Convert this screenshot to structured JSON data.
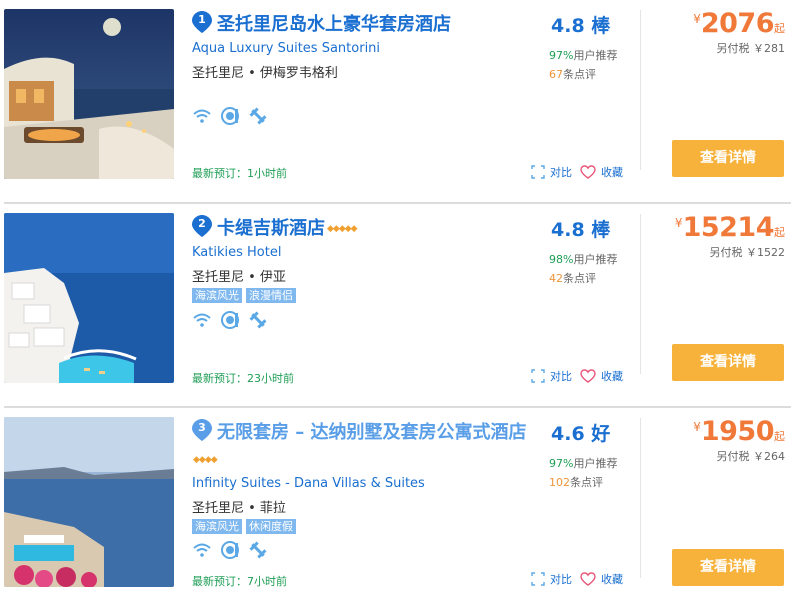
{
  "hotels": [
    {
      "rank": "1",
      "name": "圣托里尼岛水上豪华套房酒店",
      "stars_display": "",
      "en_name": "Aqua Luxury Suites Santorini",
      "location": "圣托里尼 • 伊梅罗韦格利",
      "tags": [],
      "score": "4.8 棒",
      "recommend_pct": "97%",
      "recommend_label": "用户推荐",
      "review_count": "67",
      "review_label": "条点评",
      "price_symbol": "¥",
      "price": "2076",
      "price_suffix": "起",
      "tax": "另付税 ￥281",
      "recent_booking": "最新预订：1小时前",
      "compare_label": "对比",
      "favorite_label": "收藏",
      "button_label": "查看详情",
      "facilities": [
        "wifi-icon",
        "pool-icon",
        "gym-icon"
      ]
    },
    {
      "rank": "2",
      "name": "卡缇吉斯酒店",
      "stars_display": "◆◆◆◆◆",
      "en_name": "Katikies Hotel",
      "location": "圣托里尼 • 伊亚",
      "tags": [
        "海滨风光",
        "浪漫情侣"
      ],
      "score": "4.8 棒",
      "recommend_pct": "98%",
      "recommend_label": "用户推荐",
      "review_count": "42",
      "review_label": "条点评",
      "price_symbol": "¥",
      "price": "15214",
      "price_suffix": "起",
      "tax": "另付税 ￥1522",
      "recent_booking": "最新预订：23小时前",
      "compare_label": "对比",
      "favorite_label": "收藏",
      "button_label": "查看详情",
      "facilities": [
        "wifi-icon",
        "pool-icon",
        "gym-icon"
      ]
    },
    {
      "rank": "3",
      "name": "无限套房 – 达纳别墅及套房公寓式酒店",
      "stars_display": "◆◆◆◆",
      "en_name": "Infinity Suites - Dana Villas & Suites",
      "location": "圣托里尼 • 菲拉",
      "tags": [
        "海滨风光",
        "休闲度假"
      ],
      "score": "4.6 好",
      "recommend_pct": "97%",
      "recommend_label": "用户推荐",
      "review_count": "102",
      "review_label": "条点评",
      "price_symbol": "¥",
      "price": "1950",
      "price_suffix": "起",
      "tax": "另付税 ￥264",
      "recent_booking": "最新预订：7小时前",
      "compare_label": "对比",
      "favorite_label": "收藏",
      "button_label": "查看详情",
      "facilities": [
        "wifi-icon",
        "pool-icon",
        "gym-icon"
      ]
    }
  ],
  "colors": {
    "link_blue": "#1a6fd0",
    "price_orange": "#f0793a",
    "button_orange": "#f7b23b",
    "green": "#1e9e55",
    "tag_blue": "#7fb8ef"
  }
}
